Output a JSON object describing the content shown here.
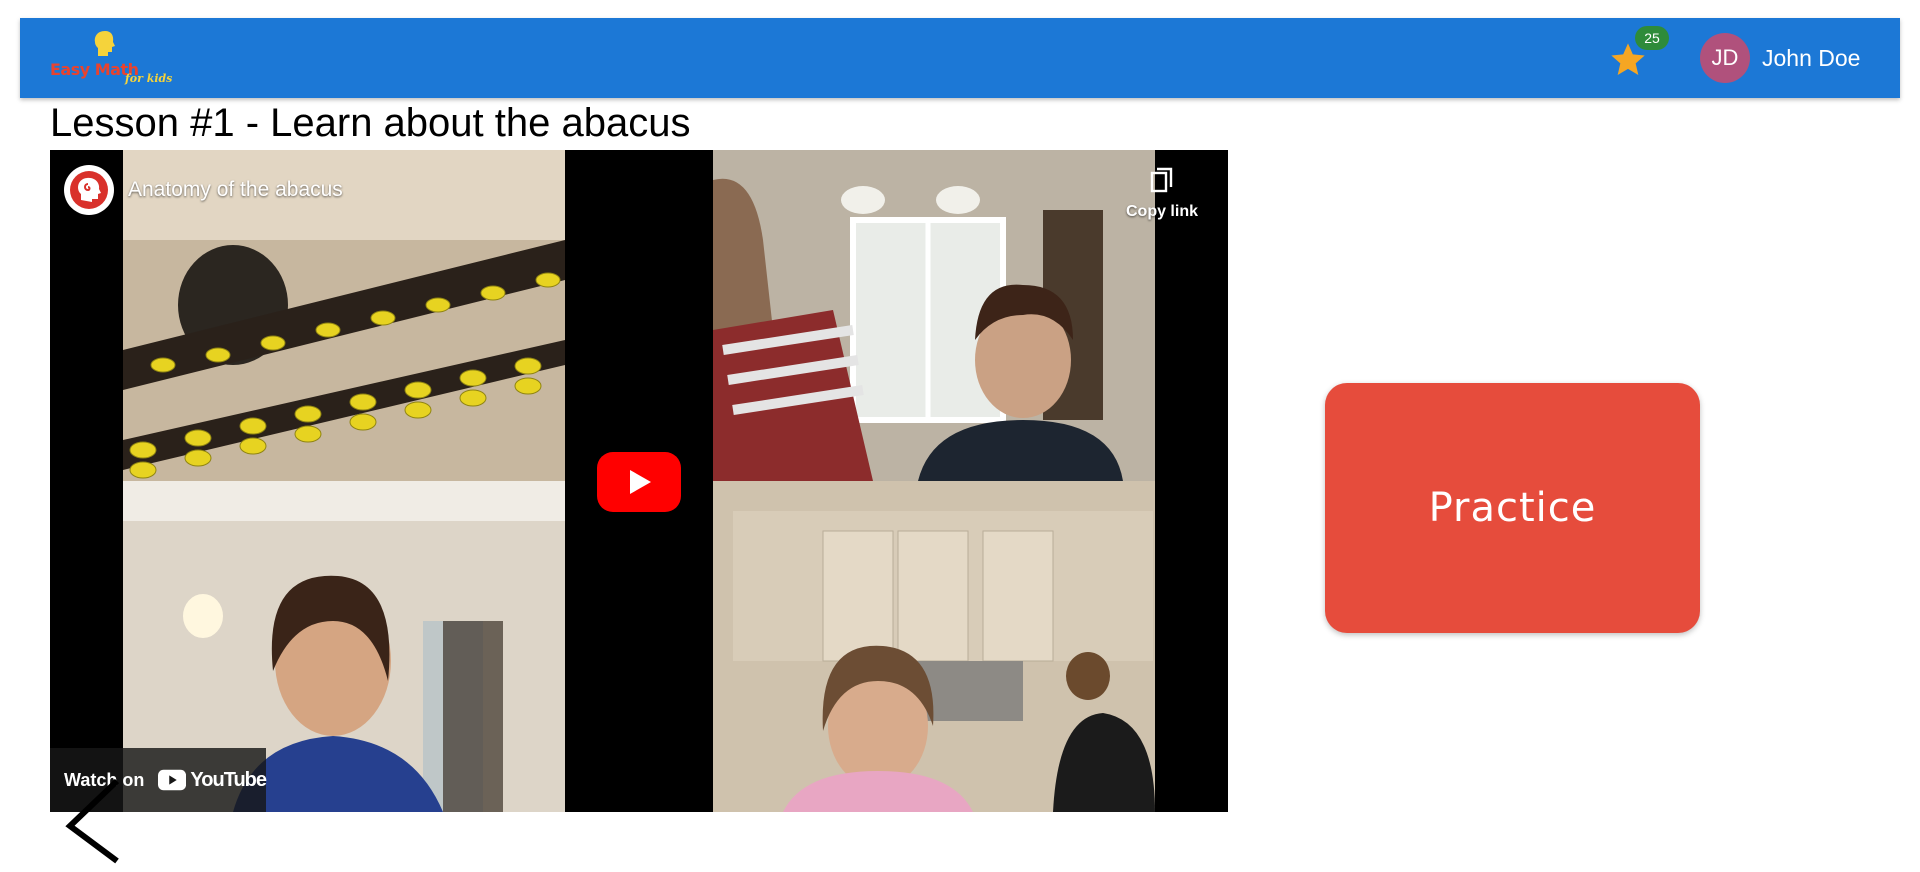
{
  "app": {
    "logo_text": "Easy Math",
    "logo_subtext": "for kids"
  },
  "header": {
    "stars_icon": "star-icon",
    "stars_count": "25",
    "user_initials": "JD",
    "user_name": "John Doe"
  },
  "lesson": {
    "title": "Lesson #1 - Learn about the abacus"
  },
  "video": {
    "title": "Anatomy of the abacus",
    "copy_link_label": "Copy link",
    "watch_on_label": "Watch on",
    "platform_label": "YouTube",
    "play_icon": "play-icon"
  },
  "actions": {
    "practice_label": "Practice",
    "back_icon": "back-arrow-icon"
  },
  "colors": {
    "header_bg": "#1c78d6",
    "practice_bg": "#e64c3c",
    "badge_bg": "#2e8b3a",
    "avatar_bg": "#b0517c",
    "star": "#f5a623"
  }
}
